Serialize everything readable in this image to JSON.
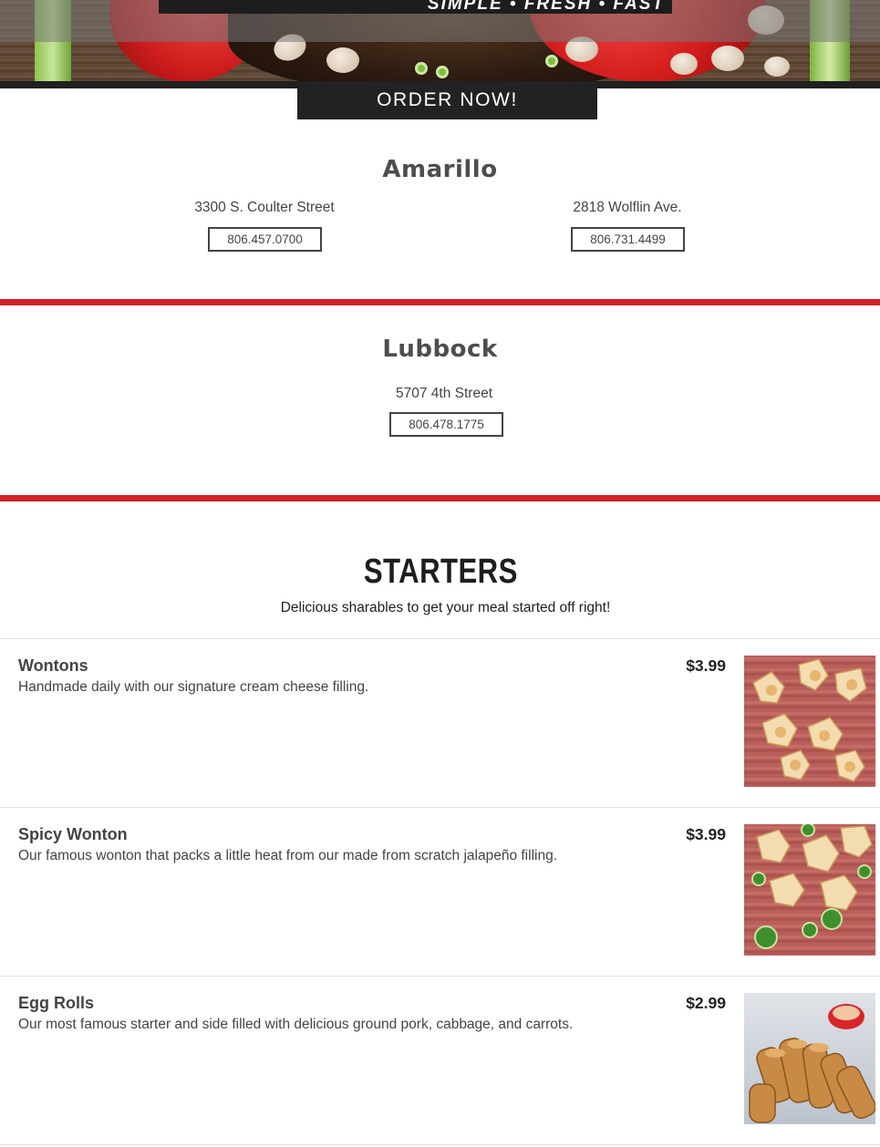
{
  "hero": {
    "tagline": "SIMPLE • FRESH • FAST"
  },
  "order_button": "ORDER NOW!",
  "locations": [
    {
      "city": "Amarillo",
      "stores": [
        {
          "address": "3300 S. Coulter Street",
          "phone": "806.457.0700"
        },
        {
          "address": "2818 Wolflin Ave.",
          "phone": "806.731.4499"
        }
      ]
    },
    {
      "city": "Lubbock",
      "stores": [
        {
          "address": "5707 4th Street",
          "phone": "806.478.1775"
        }
      ]
    }
  ],
  "starters": {
    "title": "STARTERS",
    "subtitle": "Delicious sharables to get your meal started off right!",
    "items": [
      {
        "name": "Wontons",
        "description": "Handmade daily with our signature cream cheese filling.",
        "price": "$3.99",
        "photo": "wonton-photo"
      },
      {
        "name": "Spicy Wonton",
        "description": "Our famous wonton that packs a little heat from our made from scratch jalapeño filling.",
        "price": "$3.99",
        "photo": "spicy-wonton-photo"
      },
      {
        "name": "Egg Rolls",
        "description": "Our most famous starter and side filled with delicious ground pork, cabbage, and carrots.",
        "price": "$2.99",
        "photo": "egg-roll-photo"
      }
    ]
  },
  "colors": {
    "accent_red": "#d0222a",
    "dark": "#222222",
    "text": "#444444"
  }
}
